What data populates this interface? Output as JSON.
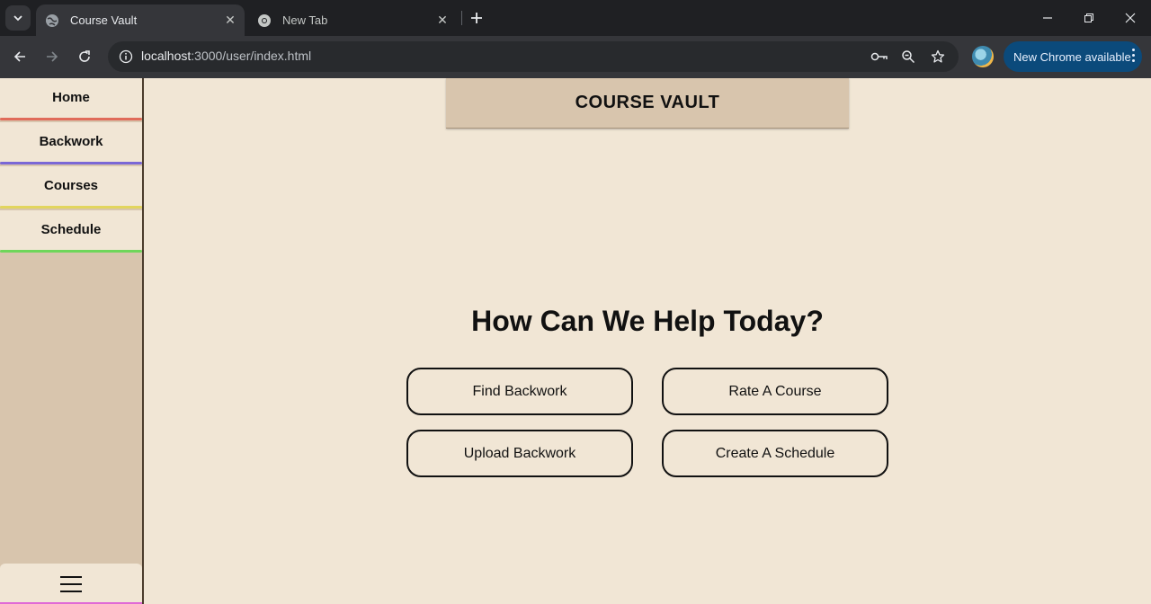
{
  "browser": {
    "tabs": [
      {
        "title": "Course Vault",
        "active": true
      },
      {
        "title": "New Tab",
        "active": false
      }
    ],
    "url_host": "localhost",
    "url_rest": ":3000/user/index.html",
    "update_label": "New Chrome available",
    "colors": {
      "frame": "#1f2023",
      "toolbar": "#35363a",
      "update_pill": "#0b4a7b"
    }
  },
  "sidebar": {
    "items": [
      {
        "label": "Home",
        "accent": "#e06b5a"
      },
      {
        "label": "Backwork",
        "accent": "#7a67d6"
      },
      {
        "label": "Courses",
        "accent": "#e2d55e"
      },
      {
        "label": "Schedule",
        "accent": "#6fd65a"
      }
    ],
    "menu_accent": "#e06ad6"
  },
  "header": {
    "title": "COURSE VAULT"
  },
  "main": {
    "heading": "How Can We Help Today?",
    "actions": [
      "Find Backwork",
      "Rate A Course",
      "Upload Backwork",
      "Create A Schedule"
    ]
  },
  "colors": {
    "page_bg": "#f1e6d5",
    "panel": "#d8c5ad",
    "text": "#111111"
  }
}
